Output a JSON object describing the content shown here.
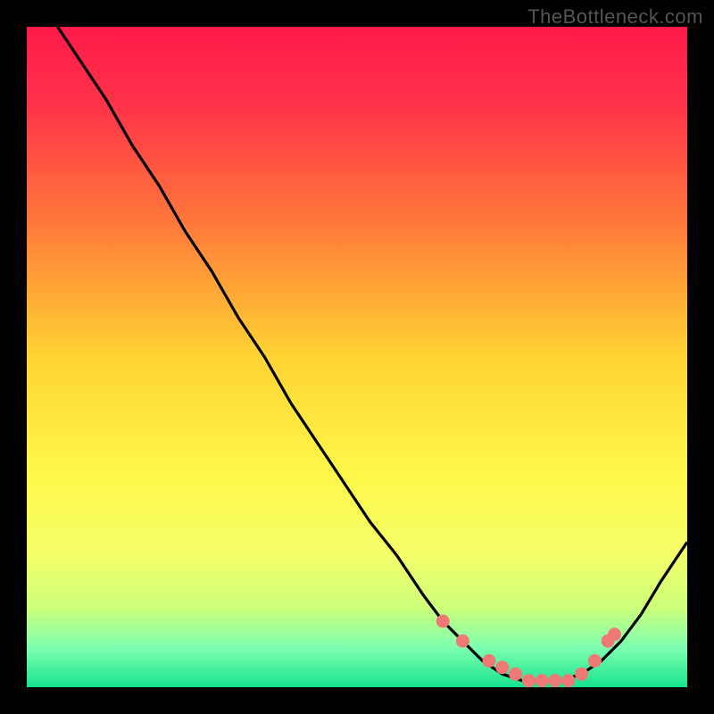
{
  "watermark": "TheBottleneck.com",
  "chart_data": {
    "type": "line",
    "title": "",
    "xlabel": "",
    "ylabel": "",
    "xlim": [
      0,
      100
    ],
    "ylim": [
      0,
      100
    ],
    "series": [
      {
        "name": "bottleneck-curve",
        "x": [
          0,
          4,
          8,
          12,
          16,
          20,
          24,
          28,
          32,
          36,
          40,
          44,
          48,
          52,
          56,
          60,
          63,
          66,
          69,
          72,
          75,
          78,
          81,
          84,
          87,
          90,
          93,
          96,
          100
        ],
        "y": [
          107,
          101,
          95,
          89,
          82,
          76,
          69,
          63,
          56,
          50,
          43,
          37,
          31,
          25,
          20,
          14,
          10,
          7,
          4,
          2,
          1,
          1,
          1,
          2,
          4,
          7,
          11,
          16,
          22
        ]
      }
    ],
    "markers": {
      "name": "highlight-dots",
      "x": [
        63,
        66,
        70,
        72,
        74,
        76,
        78,
        80,
        82,
        84,
        86,
        88,
        89
      ],
      "y": [
        10,
        7,
        4,
        3,
        2,
        1,
        1,
        1,
        1,
        2,
        4,
        7,
        8
      ]
    },
    "gradient_stops": [
      {
        "offset": 0.0,
        "color": "#ff1a4b"
      },
      {
        "offset": 0.12,
        "color": "#ff3349"
      },
      {
        "offset": 0.3,
        "color": "#ff7a3a"
      },
      {
        "offset": 0.5,
        "color": "#ffd433"
      },
      {
        "offset": 0.68,
        "color": "#fff84a"
      },
      {
        "offset": 0.8,
        "color": "#f4ff6a"
      },
      {
        "offset": 0.88,
        "color": "#ccff7a"
      },
      {
        "offset": 0.94,
        "color": "#7dffb0"
      },
      {
        "offset": 1.0,
        "color": "#17e38e"
      }
    ]
  }
}
